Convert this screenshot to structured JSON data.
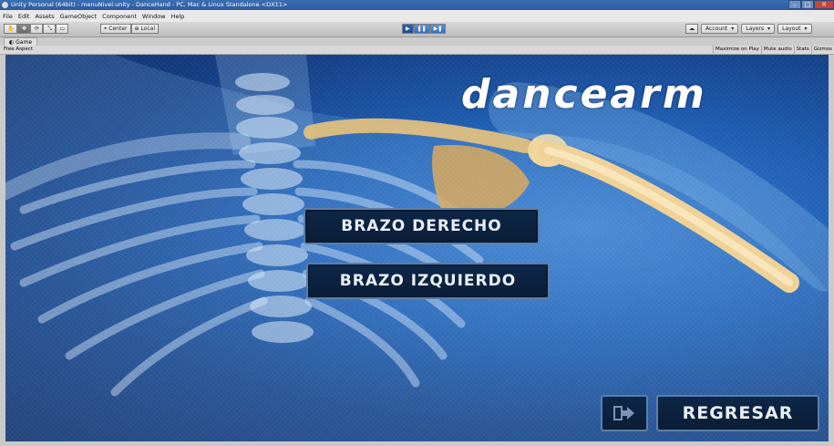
{
  "window": {
    "title": "Unity Personal (64bit) - menuNivel.unity - DanceHand - PC, Mac & Linux Standalone <DX11>",
    "controls": [
      "–",
      "□",
      "✕"
    ]
  },
  "menubar": {
    "items": [
      "File",
      "Edit",
      "Assets",
      "GameObject",
      "Component",
      "Window",
      "Help"
    ]
  },
  "toolbar": {
    "tools": [
      "✋",
      "✥",
      "⟳",
      "⤡",
      "▭"
    ],
    "pivot_label": "Center",
    "space_label": "Local",
    "play_controls": [
      "▶",
      "❚❚",
      "▶❚"
    ],
    "cloud_icon": "cloud-icon",
    "account_label": "Account",
    "layers_label": "Layers",
    "layout_label": "Layout"
  },
  "game_tab": {
    "label": "Game",
    "aspect": "Free Aspect",
    "options": [
      "Maximize on Play",
      "Mute audio",
      "Stats",
      "Gizmos"
    ]
  },
  "game": {
    "logo": "dancearm",
    "buttons": {
      "right_arm": "Brazo Derecho",
      "left_arm": "Brazo Izquierdo",
      "back": "Regresar"
    },
    "back_icon": "exit-arrow-icon"
  },
  "colors": {
    "game_bg": "#1e5eb3",
    "button_bg": "#0d2748",
    "button_border": "#5c7fa6",
    "bone": "#e8c27a"
  }
}
